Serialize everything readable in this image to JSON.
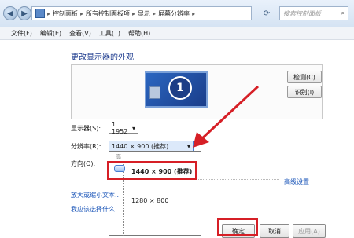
{
  "address": {
    "path": [
      "控制面板",
      "所有控制面板项",
      "显示",
      "屏幕分辨率"
    ],
    "search_placeholder": "搜索控制面板"
  },
  "menu": [
    "文件(F)",
    "编辑(E)",
    "查看(V)",
    "工具(T)",
    "帮助(H)"
  ],
  "heading": "更改显示器的外观",
  "monitor": {
    "number": "1"
  },
  "buttons": {
    "detect": "检测(C)",
    "identify": "识别(I)"
  },
  "display": {
    "label": "显示器(S):",
    "value": "1. 1952"
  },
  "resolution": {
    "label": "分辨率(R):",
    "value": "1440 × 900 (推荐)"
  },
  "orientation": {
    "label": "方向(O):"
  },
  "dropdown": {
    "top_label": "高",
    "options": [
      "1440 × 900 (推荐)",
      "1280 × 800"
    ]
  },
  "links": {
    "advanced": "高级设置",
    "enlarge": "放大或缩小文本...",
    "which_settings": "我应该选择什么..."
  },
  "footer": {
    "ok": "确定",
    "cancel": "取消",
    "apply": "应用(A)"
  },
  "colors": {
    "accent_red": "#d61f26",
    "link_blue": "#1a55b8",
    "title_blue": "#1e3c8f"
  }
}
